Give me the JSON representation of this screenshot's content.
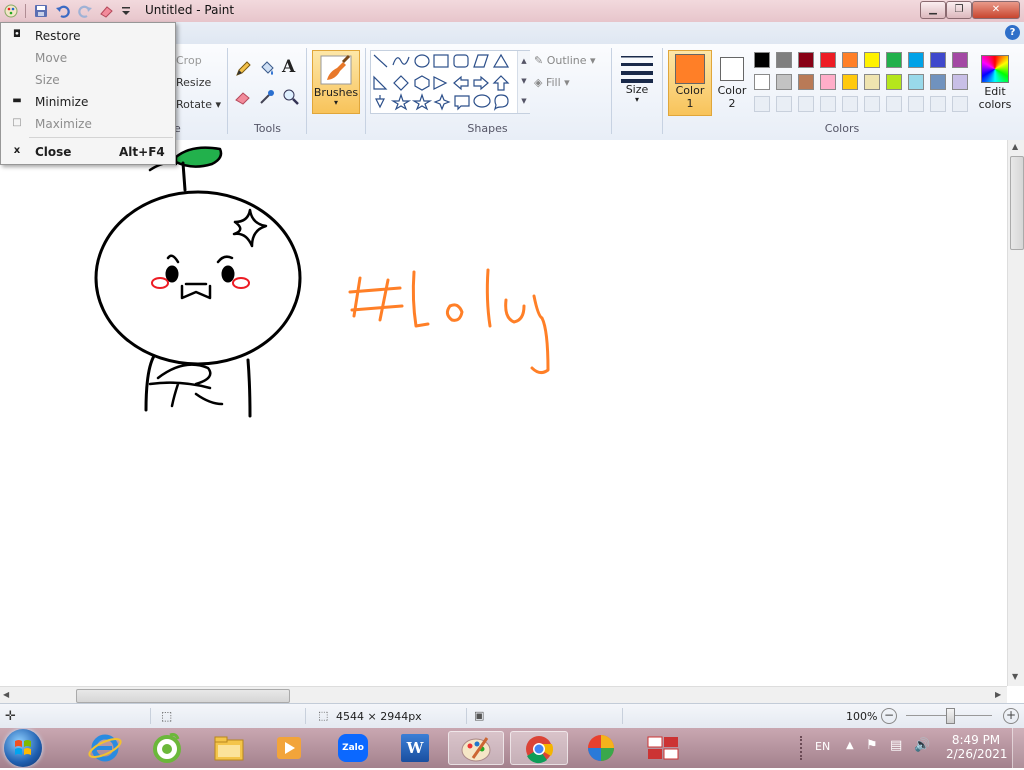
{
  "window": {
    "title": "Untitled - Paint",
    "help_glyph": "?"
  },
  "system_menu": {
    "items": [
      {
        "label": "Restore",
        "enabled": true
      },
      {
        "label": "Move",
        "enabled": false
      },
      {
        "label": "Size",
        "enabled": false
      },
      {
        "label": "Minimize",
        "enabled": true
      },
      {
        "label": "Maximize",
        "enabled": false
      },
      {
        "label": "Close",
        "shortcut": "Alt+F4",
        "enabled": true
      }
    ]
  },
  "ribbon": {
    "image_group": {
      "crop": "Crop",
      "resize": "Resize",
      "rotate": "Rotate",
      "label": "e"
    },
    "tools_label": "Tools",
    "brushes_label": "Brushes",
    "shapes": {
      "outline": "Outline",
      "fill": "Fill",
      "label": "Shapes"
    },
    "size_label": "Size",
    "color1": {
      "line1": "Color",
      "line2": "1",
      "value": "#ff7f27"
    },
    "color2": {
      "line1": "Color",
      "line2": "2",
      "value": "#ffffff"
    },
    "colors_label": "Colors",
    "edit_colors": {
      "line1": "Edit",
      "line2": "colors"
    },
    "palette_row1": [
      "#000000",
      "#7f7f7f",
      "#880015",
      "#ed1c24",
      "#ff7f27",
      "#fff200",
      "#22b14c",
      "#00a2e8",
      "#3f48cc",
      "#a349a4"
    ],
    "palette_row2": [
      "#ffffff",
      "#c3c3c3",
      "#b97a57",
      "#ffaec9",
      "#ffc90e",
      "#efe4b0",
      "#b5e61d",
      "#99d9ea",
      "#7092be",
      "#c8bfe7"
    ]
  },
  "drawing": {
    "stroke_color": "#000000",
    "leaf_color": "#22b14c",
    "blush_color": "#ed1c24",
    "text_color": "#ff7f27"
  },
  "statusbar": {
    "dimensions": "4544 × 2944px",
    "zoom": "100%"
  },
  "taskbar": {
    "apps": [
      "start-orb",
      "internet-explorer",
      "coccoc",
      "file-explorer",
      "media-player",
      "zalo",
      "word",
      "paint",
      "chrome",
      "color-app",
      "unikey"
    ],
    "zalo_label": "Zalo",
    "word_label": "W",
    "lang": "EN",
    "time": "8:49 PM",
    "date": "2/26/2021"
  }
}
